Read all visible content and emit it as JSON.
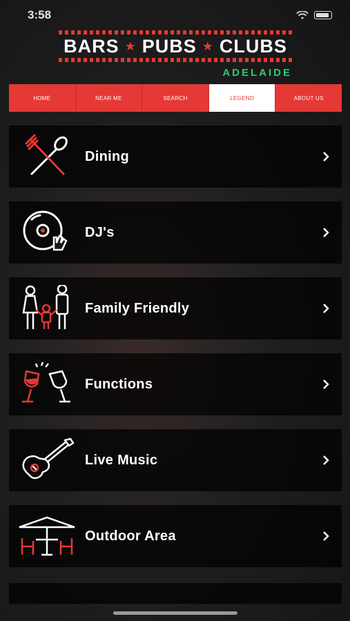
{
  "status": {
    "time": "3:58"
  },
  "brand": {
    "words": [
      "BARS",
      "PUBS",
      "CLUBS"
    ],
    "city": "ADELAIDE"
  },
  "nav": {
    "tabs": [
      "HOME",
      "NEAR ME",
      "SEARCH",
      "LEGEND",
      "ABOUT US"
    ],
    "active": "LEGEND"
  },
  "categories": [
    {
      "label": "Dining",
      "icon": "fork-spoon-icon"
    },
    {
      "label": "DJ's",
      "icon": "vinyl-record-icon"
    },
    {
      "label": "Family Friendly",
      "icon": "family-icon"
    },
    {
      "label": "Functions",
      "icon": "wine-glasses-cheers-icon"
    },
    {
      "label": "Live Music",
      "icon": "guitar-icon"
    },
    {
      "label": "Outdoor Area",
      "icon": "umbrella-table-icon"
    }
  ],
  "colors": {
    "accent": "#e53935",
    "city": "#2ecc71",
    "row_bg": "rgba(0,0,0,0.72)"
  }
}
